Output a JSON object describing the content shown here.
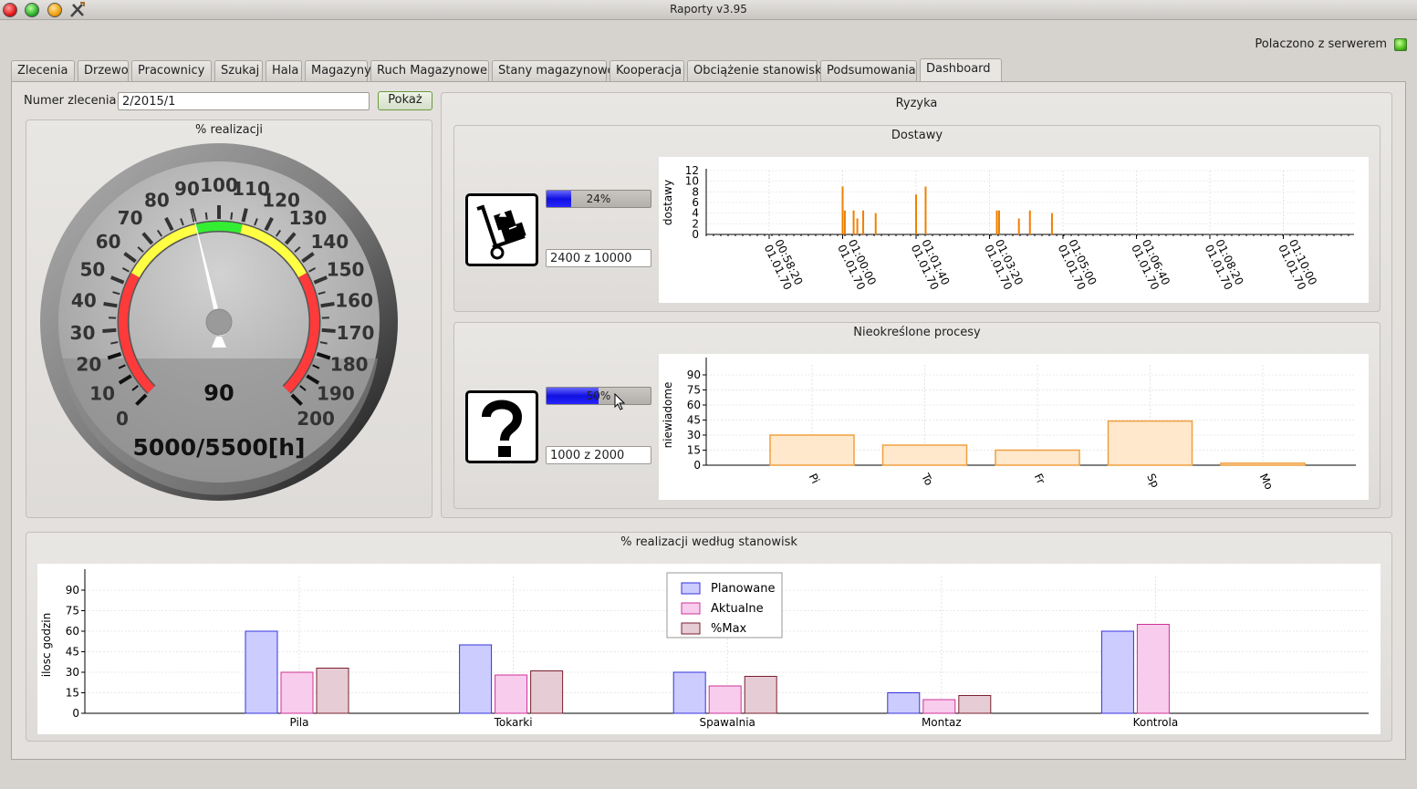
{
  "window": {
    "title": "Raporty v3.95"
  },
  "connection": {
    "label": "Polaczono z serwerem"
  },
  "tabs": [
    "Zlecenia",
    "Drzewo",
    "Pracownicy",
    "Szukaj",
    "Hala",
    "Magazyny",
    "Ruch Magazynowe",
    "Stany magazynowe",
    "Kooperacja",
    "Obciążenie stanowisk",
    "Podsumowania",
    "Dashboard"
  ],
  "active_tab": "Dashboard",
  "order": {
    "label": "Numer zlecenia",
    "value": "2/2015/1",
    "button": "Pokaż"
  },
  "realizacja": {
    "title": "% realizacji",
    "gauge_value": 90,
    "gauge_value_text": "90",
    "gauge_hours": "5000/5500[h]",
    "gauge_min": 0,
    "gauge_max": 200,
    "gauge_labels": [
      "0",
      "10",
      "20",
      "30",
      "40",
      "50",
      "60",
      "70",
      "80",
      "90",
      "100",
      "110",
      "120",
      "130",
      "140",
      "150",
      "160",
      "170",
      "180",
      "190",
      "200"
    ],
    "colors": {
      "red": "#ff3a3a",
      "yellow": "#ffff44",
      "green": "#33ee33"
    }
  },
  "ryzyka": {
    "title": "Ryzyka",
    "dostawy": {
      "title": "Dostawy",
      "icon": "hand-truck-icon",
      "progress": 24,
      "progress_text": "24%",
      "count_text": "2400 z 10000"
    },
    "procesy": {
      "title": "Nieokreślone procesy",
      "icon": "question-mark-icon",
      "progress": 50,
      "progress_text": "50%",
      "count_text": "1000 z 2000"
    }
  },
  "stanowiska": {
    "title": "% realizacji według stanowisk"
  },
  "chart_data": [
    {
      "type": "bar",
      "name": "dostawy",
      "ylabel": "dostawy",
      "ylim": [
        0,
        12
      ],
      "yticks": [
        "0",
        "2",
        "4",
        "6",
        "8",
        "10",
        "12"
      ],
      "xticks": [
        [
          "00:58:20",
          "01.01.70"
        ],
        [
          "01:00:00",
          "01.01.70"
        ],
        [
          "01:01:40",
          "01.01.70"
        ],
        [
          "01:03:20",
          "01.01.70"
        ],
        [
          "01:05:00",
          "01.01.70"
        ],
        [
          "01:06:40",
          "01.01.70"
        ],
        [
          "01:08:20",
          "01.01.70"
        ],
        [
          "01:10:00",
          "01.01.70"
        ]
      ],
      "x": [
        "01:00:00",
        "01:00:03",
        "01:00:15",
        "01:00:20",
        "01:00:28",
        "01:00:45",
        "01:01:40",
        "01:01:53",
        "01:03:30",
        "01:03:33",
        "01:04:00",
        "01:04:15",
        "01:04:45"
      ],
      "values": [
        9,
        4.5,
        4.5,
        3,
        4.5,
        4,
        7.5,
        9,
        4.5,
        4.5,
        3,
        4.5,
        4
      ],
      "color": "#f08000",
      "grid": true
    },
    {
      "type": "bar",
      "name": "procesy",
      "ylabel": "niewiadome",
      "ylim": [
        0,
        100
      ],
      "yticks": [
        "0",
        "15",
        "30",
        "45",
        "60",
        "75",
        "90"
      ],
      "categories": [
        "Pi",
        "To",
        "Fr",
        "Sp",
        "Mo"
      ],
      "values": [
        30,
        20,
        15,
        44,
        2
      ],
      "color": "#ffe8cc",
      "border": "#f0a040",
      "grid": true
    },
    {
      "type": "bar",
      "name": "stanowiska",
      "ylabel": "ilosc godzin",
      "ylim": [
        0,
        100
      ],
      "yticks": [
        "0",
        "15",
        "30",
        "45",
        "60",
        "75",
        "90"
      ],
      "categories": [
        "Pila",
        "Tokarki",
        "Spawalnia",
        "Montaz",
        "Kontrola"
      ],
      "series": [
        {
          "name": "Planowane",
          "values": [
            60,
            50,
            30,
            15,
            60
          ],
          "fill": "#ccccff",
          "stroke": "#3333dd"
        },
        {
          "name": "Aktualne",
          "values": [
            30,
            28,
            20,
            10,
            65
          ],
          "fill": "#f8ccec",
          "stroke": "#cc3399"
        },
        {
          "name": "%Max",
          "values": [
            33,
            31,
            27,
            13,
            0
          ],
          "fill": "#e6ccd4",
          "stroke": "#7a2030"
        }
      ],
      "legend": "top-center",
      "grid": true
    }
  ]
}
